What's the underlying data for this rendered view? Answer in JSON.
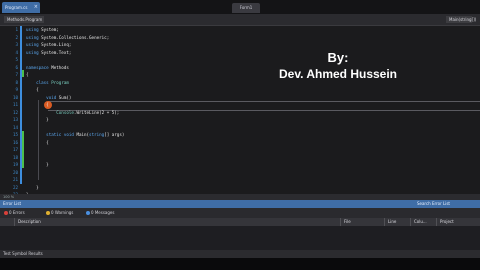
{
  "window": {
    "tab_label": "Program.cs",
    "tab_close": "×",
    "file_tab": "Form1"
  },
  "breadcrumb": {
    "left": "Methods.Program",
    "right": "Main(string[])"
  },
  "line_numbers": [
    "1",
    "2",
    "3",
    "4",
    "5",
    "6",
    "7",
    "8",
    "9",
    "10",
    "11",
    "12",
    "13",
    "14",
    "15",
    "16",
    "17",
    "18",
    "19",
    "20",
    "21",
    "22",
    "23",
    "24"
  ],
  "code_lines": [
    [
      {
        "t": "kw",
        "v": "using "
      },
      {
        "t": "mt",
        "v": "System;"
      }
    ],
    [
      {
        "t": "kw",
        "v": "using "
      },
      {
        "t": "mt",
        "v": "System.Collections.Generic;"
      }
    ],
    [
      {
        "t": "kw",
        "v": "using "
      },
      {
        "t": "mt",
        "v": "System.Linq;"
      }
    ],
    [
      {
        "t": "kw",
        "v": "using "
      },
      {
        "t": "mt",
        "v": "System.Text;"
      }
    ],
    [
      {
        "t": "mt",
        "v": ""
      }
    ],
    [
      {
        "t": "kw",
        "v": "namespace "
      },
      {
        "t": "mt",
        "v": "Methods"
      }
    ],
    [
      {
        "t": "mt",
        "v": "{"
      }
    ],
    [
      {
        "t": "mt",
        "v": "    "
      },
      {
        "t": "kw",
        "v": "class "
      },
      {
        "t": "ty",
        "v": "Program"
      }
    ],
    [
      {
        "t": "mt",
        "v": "    {"
      }
    ],
    [
      {
        "t": "mt",
        "v": "        "
      },
      {
        "t": "kw",
        "v": "void "
      },
      {
        "t": "mt",
        "v": "Sum()"
      }
    ],
    [
      {
        "t": "mt",
        "v": "        {"
      }
    ],
    [
      {
        "t": "mt",
        "v": "            "
      },
      {
        "t": "ty",
        "v": "Console"
      },
      {
        "t": "mt",
        "v": ".WriteLine(2 + 5);"
      }
    ],
    [
      {
        "t": "mt",
        "v": "        }"
      }
    ],
    [
      {
        "t": "mt",
        "v": ""
      }
    ],
    [
      {
        "t": "mt",
        "v": "        "
      },
      {
        "t": "kw",
        "v": "static void "
      },
      {
        "t": "mt",
        "v": "Main("
      },
      {
        "t": "kw",
        "v": "string"
      },
      {
        "t": "mt",
        "v": "[] args)"
      }
    ],
    [
      {
        "t": "mt",
        "v": "        {"
      }
    ],
    [
      {
        "t": "mt",
        "v": ""
      }
    ],
    [
      {
        "t": "mt",
        "v": ""
      }
    ],
    [
      {
        "t": "mt",
        "v": "        }"
      }
    ],
    [
      {
        "t": "mt",
        "v": ""
      }
    ],
    [
      {
        "t": "mt",
        "v": ""
      }
    ],
    [
      {
        "t": "mt",
        "v": "    }"
      }
    ],
    [
      {
        "t": "mt",
        "v": "}"
      }
    ],
    [
      {
        "t": "mt",
        "v": ""
      }
    ]
  ],
  "watermark": {
    "line1": "By:",
    "line2": "Dev. Ahmed Hussein"
  },
  "status": {
    "zoom": "100 %"
  },
  "error_list": {
    "title": "Error List",
    "right_title": "Search Error List",
    "filters": [
      {
        "label": "0 Errors",
        "color": "#d9403a"
      },
      {
        "label": "0 Warnings",
        "color": "#e0b030"
      },
      {
        "label": "0 Messages",
        "color": "#4a8fe0"
      }
    ],
    "columns": [
      "Description",
      "File",
      "Line",
      "Colu...",
      "Project"
    ]
  },
  "footer": {
    "label": "Test Symbol Results"
  }
}
